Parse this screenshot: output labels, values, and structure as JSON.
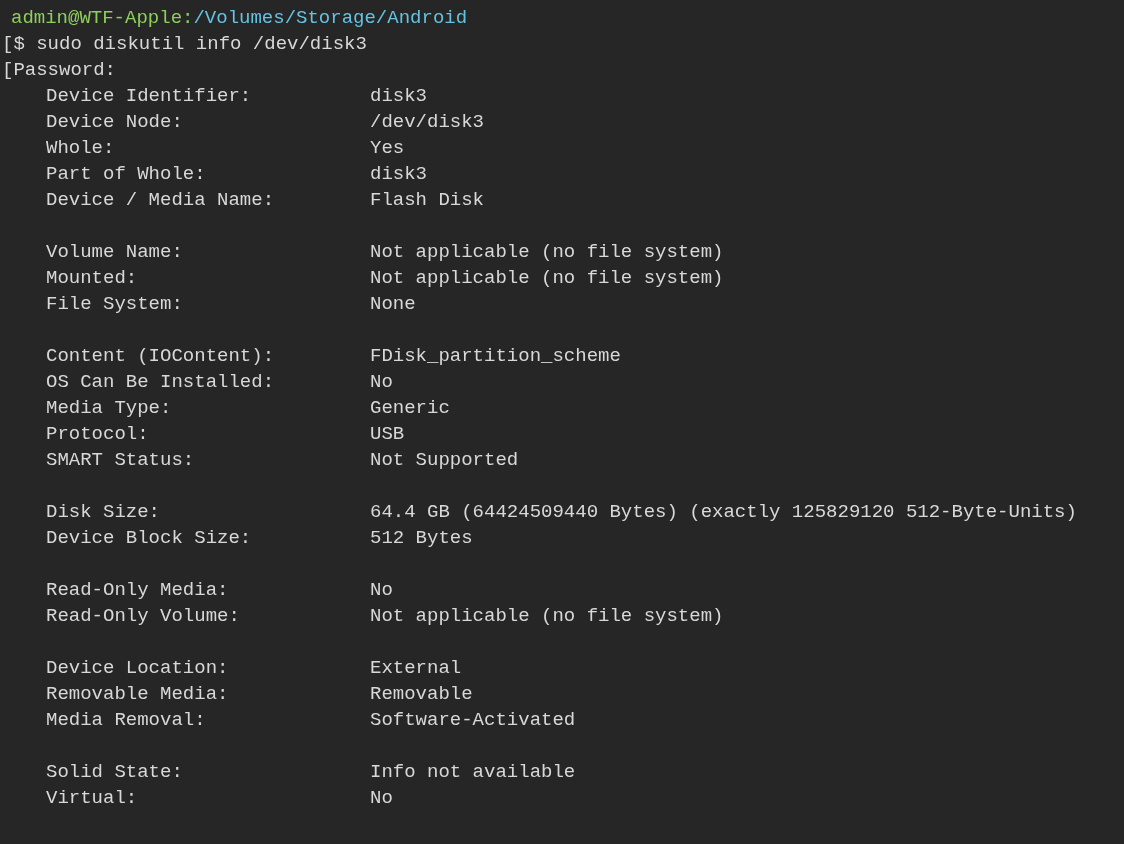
{
  "prompt": {
    "user_host": "admin@WTF-Apple:",
    "path": "/Volumes/Storage/Android"
  },
  "command": "[$ sudo diskutil info /dev/disk3",
  "password_prompt": "[Password:",
  "groups": [
    [
      {
        "label": "Device Identifier:",
        "value": "disk3"
      },
      {
        "label": "Device Node:",
        "value": "/dev/disk3"
      },
      {
        "label": "Whole:",
        "value": "Yes"
      },
      {
        "label": "Part of Whole:",
        "value": "disk3"
      },
      {
        "label": "Device / Media Name:",
        "value": "Flash Disk"
      }
    ],
    [
      {
        "label": "Volume Name:",
        "value": "Not applicable (no file system)"
      },
      {
        "label": "Mounted:",
        "value": "Not applicable (no file system)"
      },
      {
        "label": "File System:",
        "value": "None"
      }
    ],
    [
      {
        "label": "Content (IOContent):",
        "value": "FDisk_partition_scheme"
      },
      {
        "label": "OS Can Be Installed:",
        "value": "No"
      },
      {
        "label": "Media Type:",
        "value": "Generic"
      },
      {
        "label": "Protocol:",
        "value": "USB"
      },
      {
        "label": "SMART Status:",
        "value": "Not Supported"
      }
    ],
    [
      {
        "label": "Disk Size:",
        "value": "64.4 GB (64424509440 Bytes) (exactly 125829120 512-Byte-Units)"
      },
      {
        "label": "Device Block Size:",
        "value": "512 Bytes"
      }
    ],
    [
      {
        "label": "Read-Only Media:",
        "value": "No"
      },
      {
        "label": "Read-Only Volume:",
        "value": "Not applicable (no file system)"
      }
    ],
    [
      {
        "label": "Device Location:",
        "value": "External"
      },
      {
        "label": "Removable Media:",
        "value": "Removable"
      },
      {
        "label": "Media Removal:",
        "value": "Software-Activated"
      }
    ],
    [
      {
        "label": "Solid State:",
        "value": "Info not available"
      },
      {
        "label": "Virtual:",
        "value": "No"
      }
    ]
  ]
}
